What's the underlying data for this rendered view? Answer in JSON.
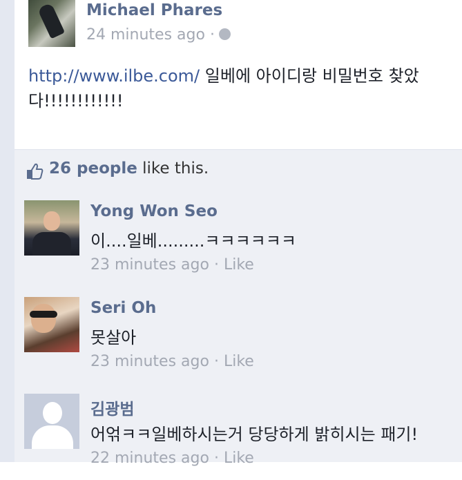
{
  "post": {
    "author": "Michael Phares",
    "time": "24 minutes ago",
    "separator": "·",
    "link_text": "http://www.ilbe.com/",
    "body_text": "일베에 아이디랑 비밀번호 찾았다!!!!!!!!!!!!",
    "privacy_icon": "globe-icon"
  },
  "likes": {
    "icon": "thumbs-up-icon",
    "count": "26 people",
    "suffix": "like this."
  },
  "comments": [
    {
      "author": "Yong Won Seo",
      "text": "이....일베.........ㅋㅋㅋㅋㅋㅋ",
      "time": "23 minutes ago",
      "separator": "·",
      "like": "Like"
    },
    {
      "author": "Seri Oh",
      "text": "못살아",
      "time": "23 minutes ago",
      "separator": "·",
      "like": "Like"
    },
    {
      "author": "김광범",
      "text": "어얶ㅋㅋ일베하시는거 당당하게 밝히시는 패기!",
      "time": "22 minutes ago",
      "separator": "·",
      "like": "Like"
    }
  ],
  "colors": {
    "name": "#5a6c8e",
    "meta": "#a3a8b3",
    "link": "#3b5998",
    "panel": "#eef0f5"
  }
}
